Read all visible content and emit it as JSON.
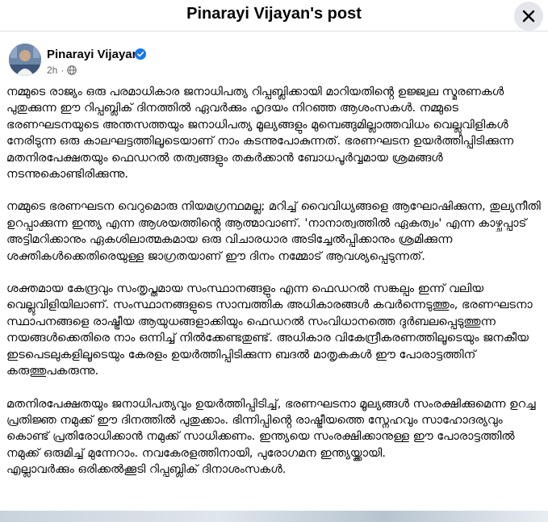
{
  "dialog": {
    "title": "Pinarayi Vijayan's post",
    "close_icon": "close-icon"
  },
  "post": {
    "author": "Pinarayi Vijayan",
    "verified_icon": "verified-badge-icon",
    "time": "2h",
    "separator": "·",
    "audience_icon": "globe-icon",
    "paragraphs": [
      "നമ്മുടെ രാജ്യം ഒരു പരമാധികാര ജനാധിപത്യ റിപ്പബ്ലിക്കായി മാറിയതിൻ്റെ ഉജ്ജ്വല സ്മരണകൾ പുതുക്കുന്ന ഈ റിപ്പബ്ലിക് ദിനത്തിൽ ഏവർക്കും ഹൃദയം നിറഞ്ഞ ആശംസകൾ. നമ്മുടെ ഭരണഘടനയുടെ അന്തസത്തയും ജനാധിപത്യ മൂല്യങ്ങളും മുമ്പെങ്ങുമില്ലാത്തവിധം വെല്ലുവിളികൾ നേരിടുന്ന ഒരു കാലഘട്ടത്തിലൂടെയാണ് നാം കടന്നുപോകുന്നത്. ഭരണഘടന ഉയർത്തിപ്പിടിക്കുന്ന മതനിരപേക്ഷതയും ഫെഡറൽ തത്വങ്ങളും തകർക്കാൻ ബോധപൂർവ്വമായ ശ്രമങ്ങൾ നടന്നുകൊണ്ടിരിക്കുന്നു.",
      "നമ്മുടെ ഭരണഘടന വെറുമൊരു നിയമഗ്രന്ഥമല്ല; മറിച്ച് വൈവിധ്യങ്ങളെ ആഘോഷിക്കുന്ന, തുല്യനീതി ഉറപ്പാക്കുന്ന ഇന്ത്യ എന്ന ആശയത്തിൻ്റെ ആത്മാവാണ്. 'നാനാത്വത്തിൽ ഏകത്വം' എന്ന കാഴ്ചപ്പാട് അട്ടിമറിക്കാനും ഏകശിലാത്മകമായ ഒരു വിചാരധാര അടിച്ചേൽപ്പിക്കാനും ശ്രമിക്കുന്ന ശക്തികൾക്കെതിരെയുള്ള ജാഗ്രതയാണ് ഈ ദിനം നമ്മോട് ആവശ്യപ്പെടുന്നത്.",
      "ശക്തമായ കേന്ദ്രവും സംതൃപ്തമായ സംസ്ഥാനങ്ങളും എന്ന ഫെഡറൽ സങ്കല്പം ഇന്ന് വലിയ വെല്ലുവിളിയിലാണ്. സംസ്ഥാനങ്ങളുടെ സാമ്പത്തിക അധികാരങ്ങൾ കവർന്നെടുത്തും, ഭരണഘടനാ സ്ഥാപനങ്ങളെ രാഷ്ട്രീയ ആയുധങ്ങളാക്കിയും ഫെഡറൽ സംവിധാനത്തെ ദുർബലപ്പെടുത്തുന്ന നയങ്ങൾക്കെതിരെ നാം ഒന്നിച്ച് നിൽക്കേണ്ടതുണ്ട്. അധികാര വികേന്ദ്രീകരണത്തിലൂടെയും ജനകീയ ഇടപെടലുകളിലൂടെയും കേരളം ഉയർത്തിപ്പിടിക്കുന്ന ബദൽ മാതൃകകൾ ഈ പോരാട്ടത്തിന് കരുത്തുപകരുന്നു.",
      "മതനിരപേക്ഷതയും ജനാധിപത്യവും ഉയർത്തിപ്പിടിച്ച്, ഭരണഘടനാ മൂല്യങ്ങൾ സംരക്ഷിക്കുമെന്ന ഉറച്ച പ്രതിജ്ഞ നമുക്ക് ഈ ദിനത്തിൽ പുതുക്കാം. ഭിന്നിപ്പിൻ്റെ രാഷ്ട്രീയത്തെ സ്നേഹവും സാഹോദര്യവും കൊണ്ട് പ്രതിരോധിക്കാൻ നമുക്ക് സാധിക്കണം. ഇന്ത്യയെ സംരക്ഷിക്കാനുള്ള ഈ പോരാട്ടത്തിൽ നമുക്ക് ഒരുമിച്ച് മുന്നേറാം. നവകേരളത്തിനായി, പുരോഗമന ഇന്ത്യയ്ക്കായി.\nഎല്ലാവർക്കും ഒരിക്കൽക്കൂടി റിപ്പബ്ലിക് ദിനാശംസകൾ."
    ]
  },
  "colors": {
    "text": "#050505",
    "secondary_text": "#65676b",
    "verified_blue": "#1877f2",
    "close_button_bg": "#e4e6eb",
    "divider": "#dddfe2"
  }
}
